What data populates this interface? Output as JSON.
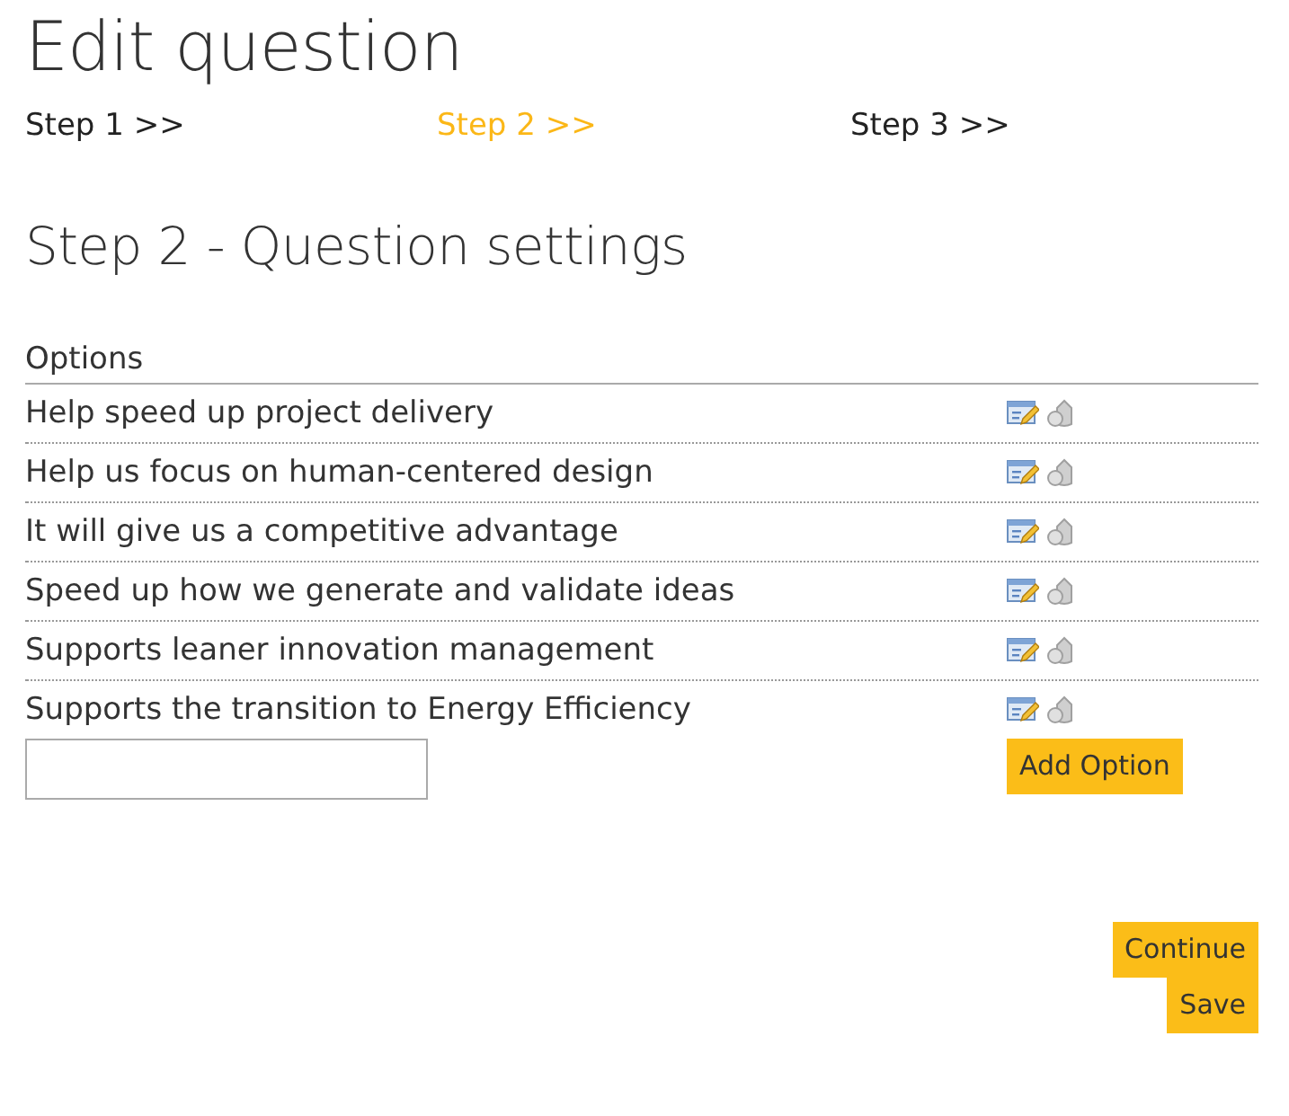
{
  "page_title": "Edit question",
  "steps": [
    {
      "label": "Step 1 >>",
      "selected": false
    },
    {
      "label": "Step 2 >>",
      "selected": true
    },
    {
      "label": "Step 3 >>",
      "selected": false
    }
  ],
  "section_title": "Step 2 - Question settings",
  "options_table": {
    "heading": "Options",
    "rows": [
      {
        "text": "Help speed up project delivery"
      },
      {
        "text": "Help us focus on human-centered design"
      },
      {
        "text": "It will give us a competitive advantage"
      },
      {
        "text": "Speed up how we generate and validate ideas"
      },
      {
        "text": "Supports leaner innovation management"
      },
      {
        "text": "Supports the transition to Energy Efficiency"
      }
    ]
  },
  "add_option_button": "Add Option",
  "buttons": [
    "Continue",
    "Save"
  ]
}
